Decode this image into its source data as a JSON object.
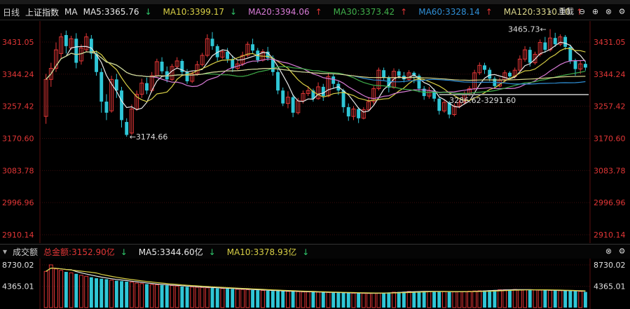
{
  "header": {
    "period": "日线",
    "index_name": "上证指数",
    "indicator": "MA",
    "ma5": "MA5:3365.76",
    "ma10": "MA10:3399.17",
    "ma20": "MA20:3394.06",
    "ma30": "MA30:3373.42",
    "ma60": "MA60:3328.14",
    "ma120": "MA120:3310.10",
    "restore_label": "重载",
    "arrow_up": "↑",
    "arrow_down": "↓"
  },
  "volume_header": {
    "title": "成交额",
    "total": "总金额:3152.90亿",
    "ma5": "MA5:3344.60亿",
    "ma10": "MA10:3378.93亿",
    "arrow_down": "↓"
  },
  "colors": {
    "up": "#e23636",
    "down": "#2fc6d6",
    "ma5": "#e8e8e8",
    "ma10": "#d8cf45",
    "ma20": "#d77bd6",
    "ma30": "#3fae4a",
    "ma60": "#2f8fd6",
    "ma120": "#d8d48a"
  },
  "chart_data": {
    "type": "candlestick",
    "y_ticks": [
      "3431.05",
      "3344.24",
      "3257.42",
      "3170.60",
      "3083.78",
      "2996.96",
      "2910.14"
    ],
    "ylim": [
      2910.14,
      3431.05
    ],
    "vol_ticks": [
      "8730.02",
      "4365.01"
    ],
    "vol_ylim": [
      0,
      8730.02
    ],
    "annotations": {
      "high": "3465.73",
      "low": "3174.66",
      "range": "3286.62-3291.60"
    },
    "candles": [
      {
        "o": 3230,
        "c": 3330,
        "h": 3345,
        "l": 3210
      },
      {
        "o": 3330,
        "c": 3360,
        "h": 3375,
        "l": 3310
      },
      {
        "o": 3360,
        "c": 3410,
        "h": 3430,
        "l": 3350
      },
      {
        "o": 3400,
        "c": 3445,
        "h": 3455,
        "l": 3385
      },
      {
        "o": 3450,
        "c": 3420,
        "h": 3462,
        "l": 3400
      },
      {
        "o": 3415,
        "c": 3440,
        "h": 3448,
        "l": 3410
      },
      {
        "o": 3440,
        "c": 3375,
        "h": 3455,
        "l": 3360
      },
      {
        "o": 3380,
        "c": 3415,
        "h": 3425,
        "l": 3370
      },
      {
        "o": 3410,
        "c": 3445,
        "h": 3455,
        "l": 3405
      },
      {
        "o": 3440,
        "c": 3400,
        "h": 3450,
        "l": 3385
      },
      {
        "o": 3400,
        "c": 3350,
        "h": 3408,
        "l": 3340
      },
      {
        "o": 3350,
        "c": 3270,
        "h": 3360,
        "l": 3240
      },
      {
        "o": 3270,
        "c": 3240,
        "h": 3290,
        "l": 3220
      },
      {
        "o": 3245,
        "c": 3330,
        "h": 3340,
        "l": 3240
      },
      {
        "o": 3330,
        "c": 3300,
        "h": 3345,
        "l": 3280
      },
      {
        "o": 3300,
        "c": 3220,
        "h": 3310,
        "l": 3200
      },
      {
        "o": 3215,
        "c": 3180,
        "h": 3225,
        "l": 3175
      },
      {
        "o": 3185,
        "c": 3250,
        "h": 3262,
        "l": 3180
      },
      {
        "o": 3250,
        "c": 3290,
        "h": 3300,
        "l": 3245
      },
      {
        "o": 3290,
        "c": 3320,
        "h": 3332,
        "l": 3280
      },
      {
        "o": 3320,
        "c": 3300,
        "h": 3335,
        "l": 3290
      },
      {
        "o": 3300,
        "c": 3340,
        "h": 3350,
        "l": 3295
      },
      {
        "o": 3340,
        "c": 3378,
        "h": 3386,
        "l": 3335
      },
      {
        "o": 3378,
        "c": 3352,
        "h": 3390,
        "l": 3345
      },
      {
        "o": 3352,
        "c": 3330,
        "h": 3365,
        "l": 3322
      },
      {
        "o": 3330,
        "c": 3365,
        "h": 3372,
        "l": 3326
      },
      {
        "o": 3365,
        "c": 3380,
        "h": 3390,
        "l": 3358
      },
      {
        "o": 3380,
        "c": 3350,
        "h": 3385,
        "l": 3340
      },
      {
        "o": 3350,
        "c": 3325,
        "h": 3358,
        "l": 3318
      },
      {
        "o": 3325,
        "c": 3345,
        "h": 3352,
        "l": 3320
      },
      {
        "o": 3345,
        "c": 3370,
        "h": 3380,
        "l": 3340
      },
      {
        "o": 3370,
        "c": 3395,
        "h": 3402,
        "l": 3365
      },
      {
        "o": 3395,
        "c": 3440,
        "h": 3452,
        "l": 3390
      },
      {
        "o": 3440,
        "c": 3420,
        "h": 3458,
        "l": 3410
      },
      {
        "o": 3420,
        "c": 3390,
        "h": 3425,
        "l": 3380
      },
      {
        "o": 3390,
        "c": 3405,
        "h": 3410,
        "l": 3385
      },
      {
        "o": 3405,
        "c": 3385,
        "h": 3415,
        "l": 3375
      },
      {
        "o": 3385,
        "c": 3360,
        "h": 3395,
        "l": 3350
      },
      {
        "o": 3360,
        "c": 3372,
        "h": 3380,
        "l": 3355
      },
      {
        "o": 3372,
        "c": 3395,
        "h": 3405,
        "l": 3366
      },
      {
        "o": 3395,
        "c": 3425,
        "h": 3432,
        "l": 3390
      },
      {
        "o": 3425,
        "c": 3408,
        "h": 3440,
        "l": 3400
      },
      {
        "o": 3408,
        "c": 3382,
        "h": 3415,
        "l": 3375
      },
      {
        "o": 3382,
        "c": 3405,
        "h": 3412,
        "l": 3378
      },
      {
        "o": 3405,
        "c": 3388,
        "h": 3418,
        "l": 3380
      },
      {
        "o": 3388,
        "c": 3350,
        "h": 3395,
        "l": 3340
      },
      {
        "o": 3350,
        "c": 3300,
        "h": 3360,
        "l": 3290
      },
      {
        "o": 3300,
        "c": 3265,
        "h": 3308,
        "l": 3258
      },
      {
        "o": 3265,
        "c": 3282,
        "h": 3298,
        "l": 3252
      },
      {
        "o": 3282,
        "c": 3240,
        "h": 3290,
        "l": 3228
      },
      {
        "o": 3240,
        "c": 3272,
        "h": 3280,
        "l": 3235
      },
      {
        "o": 3272,
        "c": 3292,
        "h": 3300,
        "l": 3265
      },
      {
        "o": 3292,
        "c": 3300,
        "h": 3312,
        "l": 3285
      },
      {
        "o": 3300,
        "c": 3278,
        "h": 3305,
        "l": 3270
      },
      {
        "o": 3278,
        "c": 3310,
        "h": 3322,
        "l": 3275
      },
      {
        "o": 3310,
        "c": 3285,
        "h": 3318,
        "l": 3272
      },
      {
        "o": 3285,
        "c": 3338,
        "h": 3348,
        "l": 3282
      },
      {
        "o": 3338,
        "c": 3318,
        "h": 3345,
        "l": 3305
      },
      {
        "o": 3318,
        "c": 3300,
        "h": 3325,
        "l": 3288
      },
      {
        "o": 3300,
        "c": 3255,
        "h": 3305,
        "l": 3240
      },
      {
        "o": 3255,
        "c": 3230,
        "h": 3265,
        "l": 3218
      },
      {
        "o": 3230,
        "c": 3250,
        "h": 3258,
        "l": 3220
      },
      {
        "o": 3250,
        "c": 3225,
        "h": 3255,
        "l": 3212
      },
      {
        "o": 3225,
        "c": 3248,
        "h": 3255,
        "l": 3222
      },
      {
        "o": 3248,
        "c": 3270,
        "h": 3282,
        "l": 3245
      },
      {
        "o": 3270,
        "c": 3305,
        "h": 3312,
        "l": 3262
      },
      {
        "o": 3305,
        "c": 3355,
        "h": 3362,
        "l": 3300
      },
      {
        "o": 3355,
        "c": 3335,
        "h": 3362,
        "l": 3328
      },
      {
        "o": 3335,
        "c": 3308,
        "h": 3340,
        "l": 3295
      },
      {
        "o": 3308,
        "c": 3352,
        "h": 3360,
        "l": 3305
      },
      {
        "o": 3352,
        "c": 3340,
        "h": 3358,
        "l": 3332
      },
      {
        "o": 3340,
        "c": 3330,
        "h": 3350,
        "l": 3322
      },
      {
        "o": 3330,
        "c": 3348,
        "h": 3355,
        "l": 3325
      },
      {
        "o": 3348,
        "c": 3340,
        "h": 3352,
        "l": 3320
      },
      {
        "o": 3340,
        "c": 3305,
        "h": 3345,
        "l": 3295
      },
      {
        "o": 3305,
        "c": 3285,
        "h": 3312,
        "l": 3275
      },
      {
        "o": 3285,
        "c": 3300,
        "h": 3310,
        "l": 3278
      },
      {
        "o": 3300,
        "c": 3278,
        "h": 3305,
        "l": 3270
      },
      {
        "o": 3278,
        "c": 3245,
        "h": 3282,
        "l": 3235
      },
      {
        "o": 3245,
        "c": 3268,
        "h": 3275,
        "l": 3240
      },
      {
        "o": 3268,
        "c": 3235,
        "h": 3272,
        "l": 3225
      },
      {
        "o": 3235,
        "c": 3258,
        "h": 3265,
        "l": 3230
      },
      {
        "o": 3258,
        "c": 3268,
        "h": 3275,
        "l": 3252
      },
      {
        "o": 3268,
        "c": 3290,
        "h": 3298,
        "l": 3262
      },
      {
        "o": 3290,
        "c": 3305,
        "h": 3312,
        "l": 3285
      },
      {
        "o": 3305,
        "c": 3348,
        "h": 3356,
        "l": 3300
      },
      {
        "o": 3348,
        "c": 3368,
        "h": 3376,
        "l": 3342
      },
      {
        "o": 3368,
        "c": 3356,
        "h": 3375,
        "l": 3345
      },
      {
        "o": 3356,
        "c": 3332,
        "h": 3362,
        "l": 3325
      },
      {
        "o": 3332,
        "c": 3312,
        "h": 3338,
        "l": 3305
      },
      {
        "o": 3312,
        "c": 3328,
        "h": 3335,
        "l": 3308
      },
      {
        "o": 3328,
        "c": 3348,
        "h": 3355,
        "l": 3322
      },
      {
        "o": 3348,
        "c": 3338,
        "h": 3352,
        "l": 3330
      },
      {
        "o": 3338,
        "c": 3355,
        "h": 3362,
        "l": 3332
      },
      {
        "o": 3355,
        "c": 3385,
        "h": 3395,
        "l": 3350
      },
      {
        "o": 3385,
        "c": 3410,
        "h": 3420,
        "l": 3378
      },
      {
        "o": 3410,
        "c": 3375,
        "h": 3418,
        "l": 3365
      },
      {
        "o": 3375,
        "c": 3398,
        "h": 3405,
        "l": 3370
      },
      {
        "o": 3398,
        "c": 3430,
        "h": 3438,
        "l": 3392
      },
      {
        "o": 3430,
        "c": 3410,
        "h": 3445,
        "l": 3402
      },
      {
        "o": 3410,
        "c": 3442,
        "h": 3466,
        "l": 3405
      },
      {
        "o": 3442,
        "c": 3425,
        "h": 3456,
        "l": 3418
      },
      {
        "o": 3425,
        "c": 3445,
        "h": 3452,
        "l": 3420
      },
      {
        "o": 3445,
        "c": 3418,
        "h": 3450,
        "l": 3410
      },
      {
        "o": 3418,
        "c": 3380,
        "h": 3424,
        "l": 3372
      },
      {
        "o": 3380,
        "c": 3358,
        "h": 3386,
        "l": 3340
      },
      {
        "o": 3358,
        "c": 3372,
        "h": 3380,
        "l": 3345
      },
      {
        "o": 3372,
        "c": 3362,
        "h": 3378,
        "l": 3354
      }
    ],
    "volumes": [
      7400,
      8730,
      7900,
      7600,
      7300,
      7100,
      6900,
      6600,
      6400,
      6200,
      6000,
      5900,
      5800,
      5600,
      5500,
      5400,
      5300,
      5200,
      5000,
      4900,
      4800,
      4700,
      4650,
      4600,
      4550,
      4500,
      4400,
      4300,
      4250,
      4200,
      4150,
      4100,
      4050,
      4000,
      3950,
      3900,
      3850,
      3800,
      3750,
      3700,
      3650,
      3600,
      3550,
      3500,
      3450,
      3400,
      3400,
      3350,
      3300,
      3300,
      3250,
      3200,
      3200,
      3150,
      3150,
      3100,
      3100,
      3050,
      3050,
      3000,
      3000,
      2950,
      2950,
      2900,
      2900,
      2950,
      3000,
      3050,
      3100,
      3150,
      3200,
      3250,
      3300,
      3300,
      3350,
      3350,
      3300,
      3300,
      3250,
      3250,
      3200,
      3200,
      3250,
      3300,
      3350,
      3400,
      3450,
      3500,
      3550,
      3600,
      3650,
      3650,
      3700,
      3700,
      3650,
      3650,
      3600,
      3600,
      3550,
      3550,
      3500,
      3500,
      3450,
      3450,
      3400,
      3350,
      3300,
      3200
    ]
  }
}
